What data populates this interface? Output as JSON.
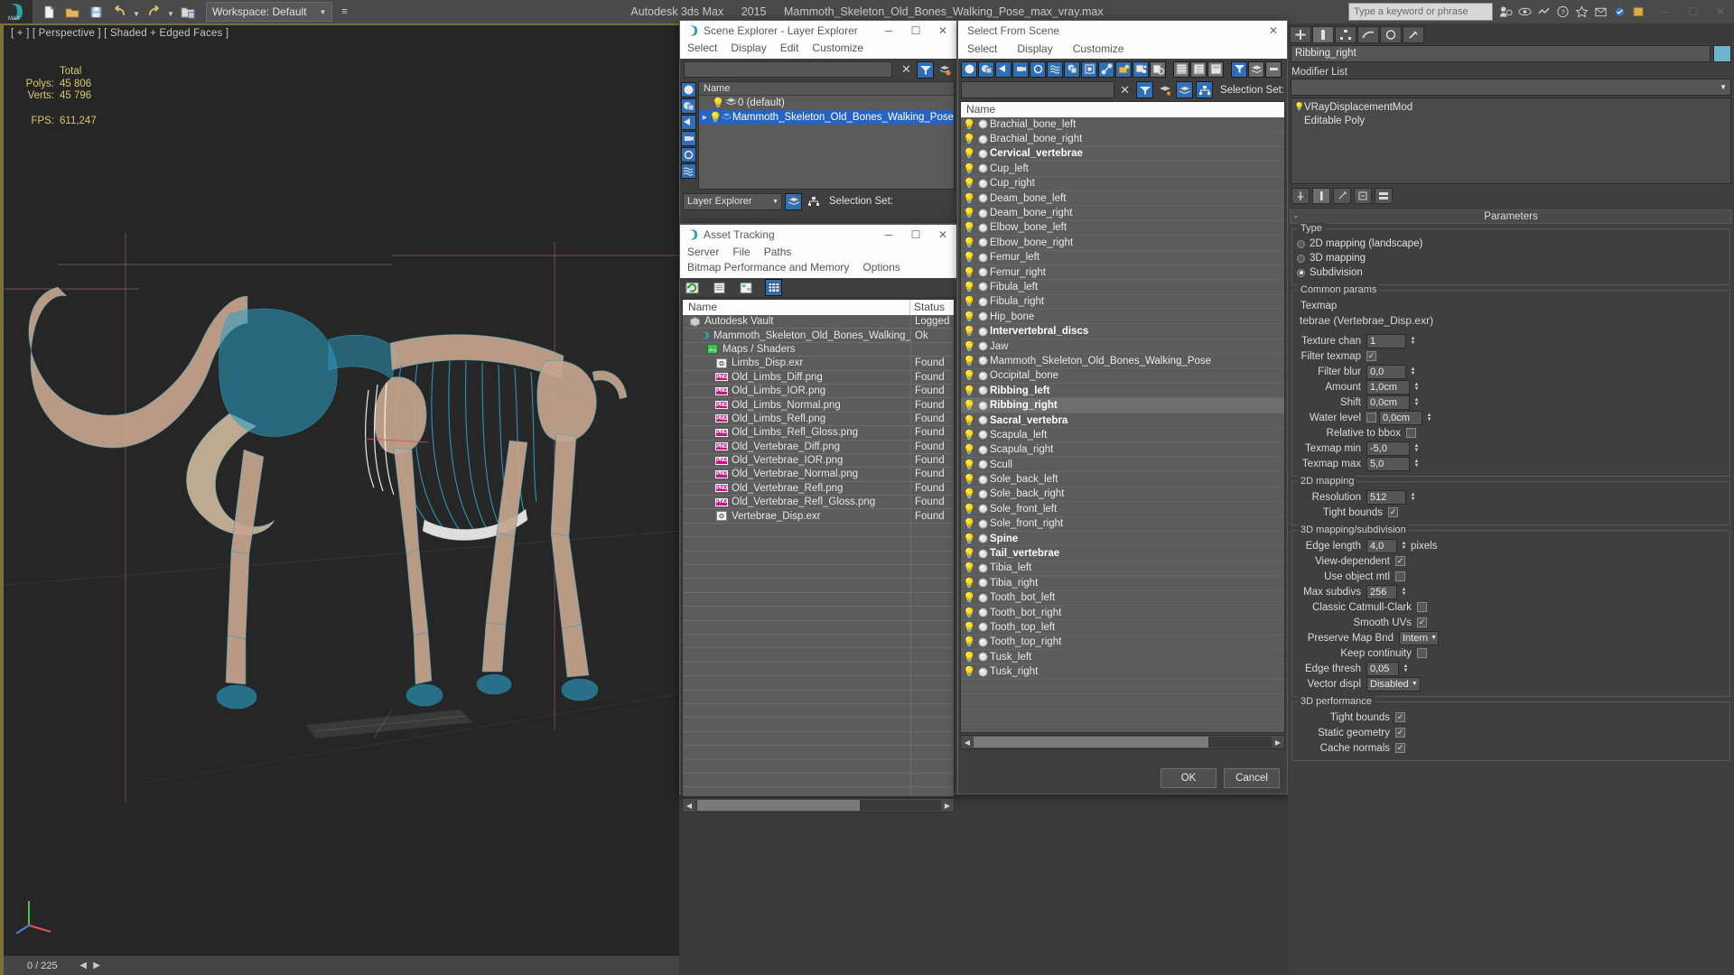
{
  "titlebar": {
    "app_name": "Autodesk 3ds Max",
    "version": "2015",
    "file_name": "Mammoth_Skeleton_Old_Bones_Walking_Pose_max_vray.max",
    "workspace_label": "Workspace: Default",
    "search_placeholder": "Type a keyword or phrase",
    "minimize": "─",
    "maximize": "☐",
    "close": "✕"
  },
  "viewport": {
    "label": "[ + ] [ Perspective ] [ Shaded + Edged Faces ]",
    "stats": {
      "header": "Total",
      "polys_label": "Polys:",
      "polys_value": "45 806",
      "verts_label": "Verts:",
      "verts_value": "45 796",
      "fps_label": "FPS:",
      "fps_value": "611,247"
    },
    "frame_counter": "0 / 225"
  },
  "scene_explorer": {
    "title": "Scene Explorer - Layer Explorer",
    "menus": [
      "Select",
      "Display",
      "Edit",
      "Customize"
    ],
    "column_header": "Name",
    "rows": [
      {
        "name": "0 (default)",
        "selected": false,
        "expandable": false
      },
      {
        "name": "Mammoth_Skeleton_Old_Bones_Walking_Pose",
        "selected": true,
        "expandable": true
      }
    ],
    "combo_value": "Layer Explorer",
    "selection_set_label": "Selection Set:"
  },
  "asset_tracking": {
    "title": "Asset Tracking",
    "menus": [
      "Server",
      "File",
      "Paths",
      "Bitmap Performance and Memory",
      "Options"
    ],
    "columns": [
      "Name",
      "Status"
    ],
    "rows": [
      {
        "name": "Autodesk Vault",
        "status": "Logged",
        "icon": "vault-icon",
        "indent": 1
      },
      {
        "name": "Mammoth_Skeleton_Old_Bones_Walking_Pose_...",
        "status": "Ok",
        "icon": "max-icon",
        "indent": 2
      },
      {
        "name": "Maps / Shaders",
        "status": "",
        "icon": "maps-icon",
        "indent": 3
      },
      {
        "name": "Limbs_Disp.exr",
        "status": "Found",
        "icon": "exr-icon",
        "indent": 4
      },
      {
        "name": "Old_Limbs_Diff.png",
        "status": "Found",
        "icon": "png-icon",
        "indent": 4
      },
      {
        "name": "Old_Limbs_IOR.png",
        "status": "Found",
        "icon": "png-icon",
        "indent": 4
      },
      {
        "name": "Old_Limbs_Normal.png",
        "status": "Found",
        "icon": "png-icon",
        "indent": 4
      },
      {
        "name": "Old_Limbs_Refl.png",
        "status": "Found",
        "icon": "png-icon",
        "indent": 4
      },
      {
        "name": "Old_Limbs_Refl_Gloss.png",
        "status": "Found",
        "icon": "png-icon",
        "indent": 4
      },
      {
        "name": "Old_Vertebrae_Diff.png",
        "status": "Found",
        "icon": "png-icon",
        "indent": 4
      },
      {
        "name": "Old_Vertebrae_IOR.png",
        "status": "Found",
        "icon": "png-icon",
        "indent": 4
      },
      {
        "name": "Old_Vertebrae_Normal.png",
        "status": "Found",
        "icon": "png-icon",
        "indent": 4
      },
      {
        "name": "Old_Vertebrae_Refl.png",
        "status": "Found",
        "icon": "png-icon",
        "indent": 4
      },
      {
        "name": "Old_Vertebrae_Refl_Gloss.png",
        "status": "Found",
        "icon": "png-icon",
        "indent": 4
      },
      {
        "name": "Vertebrae_Disp.exr",
        "status": "Found",
        "icon": "exr-icon",
        "indent": 4
      }
    ]
  },
  "select_from_scene": {
    "title": "Select From Scene",
    "menus": [
      "Select",
      "Display",
      "Customize"
    ],
    "column_header": "Name",
    "selection_set_label": "Selection Set:",
    "ok_label": "OK",
    "cancel_label": "Cancel",
    "objects": [
      {
        "name": "Brachial_bone_left",
        "bold": false,
        "highlight": false
      },
      {
        "name": "Brachial_bone_right",
        "bold": false,
        "highlight": false
      },
      {
        "name": "Cervical_vertebrae",
        "bold": true,
        "highlight": false
      },
      {
        "name": "Cup_left",
        "bold": false,
        "highlight": false
      },
      {
        "name": "Cup_right",
        "bold": false,
        "highlight": false
      },
      {
        "name": "Deam_bone_left",
        "bold": false,
        "highlight": false
      },
      {
        "name": "Deam_bone_right",
        "bold": false,
        "highlight": false
      },
      {
        "name": "Elbow_bone_left",
        "bold": false,
        "highlight": false
      },
      {
        "name": "Elbow_bone_right",
        "bold": false,
        "highlight": false
      },
      {
        "name": "Femur_left",
        "bold": false,
        "highlight": false
      },
      {
        "name": "Femur_right",
        "bold": false,
        "highlight": false
      },
      {
        "name": "Fibula_left",
        "bold": false,
        "highlight": false
      },
      {
        "name": "Fibula_right",
        "bold": false,
        "highlight": false
      },
      {
        "name": "Hip_bone",
        "bold": false,
        "highlight": false
      },
      {
        "name": "Intervertebral_discs",
        "bold": true,
        "highlight": false
      },
      {
        "name": "Jaw",
        "bold": false,
        "highlight": false
      },
      {
        "name": "Mammoth_Skeleton_Old_Bones_Walking_Pose",
        "bold": false,
        "highlight": false
      },
      {
        "name": "Occipital_bone",
        "bold": false,
        "highlight": false
      },
      {
        "name": "Ribbing_left",
        "bold": true,
        "highlight": false
      },
      {
        "name": "Ribbing_right",
        "bold": true,
        "highlight": true
      },
      {
        "name": "Sacral_vertebra",
        "bold": true,
        "highlight": false
      },
      {
        "name": "Scapula_left",
        "bold": false,
        "highlight": false
      },
      {
        "name": "Scapula_right",
        "bold": false,
        "highlight": false
      },
      {
        "name": "Scull",
        "bold": false,
        "highlight": false
      },
      {
        "name": "Sole_back_left",
        "bold": false,
        "highlight": false
      },
      {
        "name": "Sole_back_right",
        "bold": false,
        "highlight": false
      },
      {
        "name": "Sole_front_left",
        "bold": false,
        "highlight": false
      },
      {
        "name": "Sole_front_right",
        "bold": false,
        "highlight": false
      },
      {
        "name": "Spine",
        "bold": true,
        "highlight": false
      },
      {
        "name": "Tail_vertebrae",
        "bold": true,
        "highlight": false
      },
      {
        "name": "Tibia_left",
        "bold": false,
        "highlight": false
      },
      {
        "name": "Tibia_right",
        "bold": false,
        "highlight": false
      },
      {
        "name": "Tooth_bot_left",
        "bold": false,
        "highlight": false
      },
      {
        "name": "Tooth_bot_right",
        "bold": false,
        "highlight": false
      },
      {
        "name": "Tooth_top_left",
        "bold": false,
        "highlight": false
      },
      {
        "name": "Tooth_top_right",
        "bold": false,
        "highlight": false
      },
      {
        "name": "Tusk_left",
        "bold": false,
        "highlight": false
      },
      {
        "name": "Tusk_right",
        "bold": false,
        "highlight": false
      }
    ]
  },
  "command_panel": {
    "object_name": "Ribbing_right",
    "object_color": "#5ab7d4",
    "modifier_list_label": "Modifier List",
    "stack": [
      {
        "name": "VRayDisplacementMod",
        "type": "modifier"
      },
      {
        "name": "Editable Poly",
        "type": "base"
      }
    ],
    "parameters_rollout": "Parameters",
    "type_group": {
      "label": "Type",
      "options": [
        {
          "label": "2D mapping (landscape)",
          "selected": false
        },
        {
          "label": "3D mapping",
          "selected": false
        },
        {
          "label": "Subdivision",
          "selected": true
        }
      ]
    },
    "common_params": {
      "label": "Common params",
      "texmap_label": "Texmap",
      "texmap_value": "tebrae (Vertebrae_Disp.exr)",
      "texture_chan_label": "Texture chan",
      "texture_chan_value": "1",
      "filter_texmap_label": "Filter texmap",
      "filter_texmap_checked": true,
      "filter_blur_label": "Filter blur",
      "filter_blur_value": "0,0",
      "amount_label": "Amount",
      "amount_value": "1,0cm",
      "shift_label": "Shift",
      "shift_value": "0,0cm",
      "water_level_label": "Water level",
      "water_level_checked": false,
      "water_level_value": "0,0cm",
      "relative_to_bbox_label": "Relative to bbox",
      "relative_to_bbox_checked": false,
      "texmap_min_label": "Texmap min",
      "texmap_min_value": "-5,0",
      "texmap_max_label": "Texmap max",
      "texmap_max_value": "5,0"
    },
    "mapping_2d": {
      "label": "2D mapping",
      "resolution_label": "Resolution",
      "resolution_value": "512",
      "tight_bounds_label": "Tight bounds",
      "tight_bounds_checked": true
    },
    "mapping_3d": {
      "label": "3D mapping/subdivision",
      "edge_length_label": "Edge length",
      "edge_length_value": "4,0",
      "edge_length_unit": "pixels",
      "view_dependent_label": "View-dependent",
      "view_dependent_checked": true,
      "use_object_mtl_label": "Use object mtl",
      "use_object_mtl_checked": false,
      "max_subdivs_label": "Max subdivs",
      "max_subdivs_value": "256",
      "classic_catmull_label": "Classic Catmull-Clark",
      "classic_catmull_checked": false,
      "smooth_uvs_label": "Smooth UVs",
      "smooth_uvs_checked": true,
      "preserve_map_bnd_label": "Preserve Map Bnd",
      "preserve_map_bnd_value": "Intern",
      "keep_continuity_label": "Keep continuity",
      "keep_continuity_checked": false,
      "edge_thresh_label": "Edge thresh",
      "edge_thresh_value": "0,05",
      "vector_displ_label": "Vector displ",
      "vector_displ_value": "Disabled"
    },
    "performance_3d": {
      "label": "3D performance",
      "tight_bounds_label": "Tight bounds",
      "tight_bounds_checked": true,
      "static_geometry_label": "Static geometry",
      "static_geometry_checked": true,
      "cache_normals_label": "Cache normals",
      "cache_normals_checked": true
    }
  }
}
